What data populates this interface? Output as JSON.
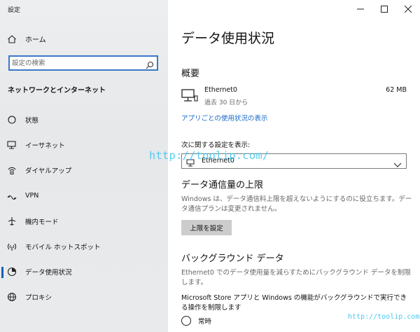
{
  "app_title": "設定",
  "sidebar": {
    "home_label": "ホーム",
    "search_placeholder": "設定の検索",
    "section_heading": "ネットワークとインターネット",
    "items": [
      {
        "label": "状態",
        "icon": "status-icon"
      },
      {
        "label": "イーサネット",
        "icon": "ethernet-icon"
      },
      {
        "label": "ダイヤルアップ",
        "icon": "dialup-icon"
      },
      {
        "label": "VPN",
        "icon": "vpn-icon"
      },
      {
        "label": "機内モード",
        "icon": "airplane-icon"
      },
      {
        "label": "モバイル ホットスポット",
        "icon": "hotspot-icon"
      },
      {
        "label": "データ使用状況",
        "icon": "data-usage-icon",
        "active": true
      },
      {
        "label": "プロキシ",
        "icon": "globe-icon"
      }
    ]
  },
  "main": {
    "title": "データ使用状況",
    "overview": {
      "heading": "概要",
      "connection_name": "Ethernet0",
      "period": "過去 30 日から",
      "usage": "62 MB"
    },
    "app_usage_link": "アプリごとの使用状況の表示",
    "show_settings_label": "次に関する設定を表示:",
    "selected_connection": "Ethernet0",
    "data_limit": {
      "heading": "データ通信量の上限",
      "description": "Windows は、データ通信料上限を超えないようにするのに役立ちます。データ通信プランは変更されません。",
      "button": "上限を設定"
    },
    "background_data": {
      "heading": "バックグラウンド データ",
      "description": "Ethernet0 でのデータ使用量を減らすためにバックグラウンド データを制限します。",
      "store_text": "Microsoft Store アプリと Windows の機能がバックグラウンドで実行できる操作を制限します",
      "option_always": "常時"
    }
  },
  "watermarks": {
    "center": "http://toolip.com/",
    "corner": "http://toolip.com"
  },
  "colors": {
    "accent": "#1a5fb4",
    "link": "#1766c8",
    "watermark": "#35c4f0"
  }
}
